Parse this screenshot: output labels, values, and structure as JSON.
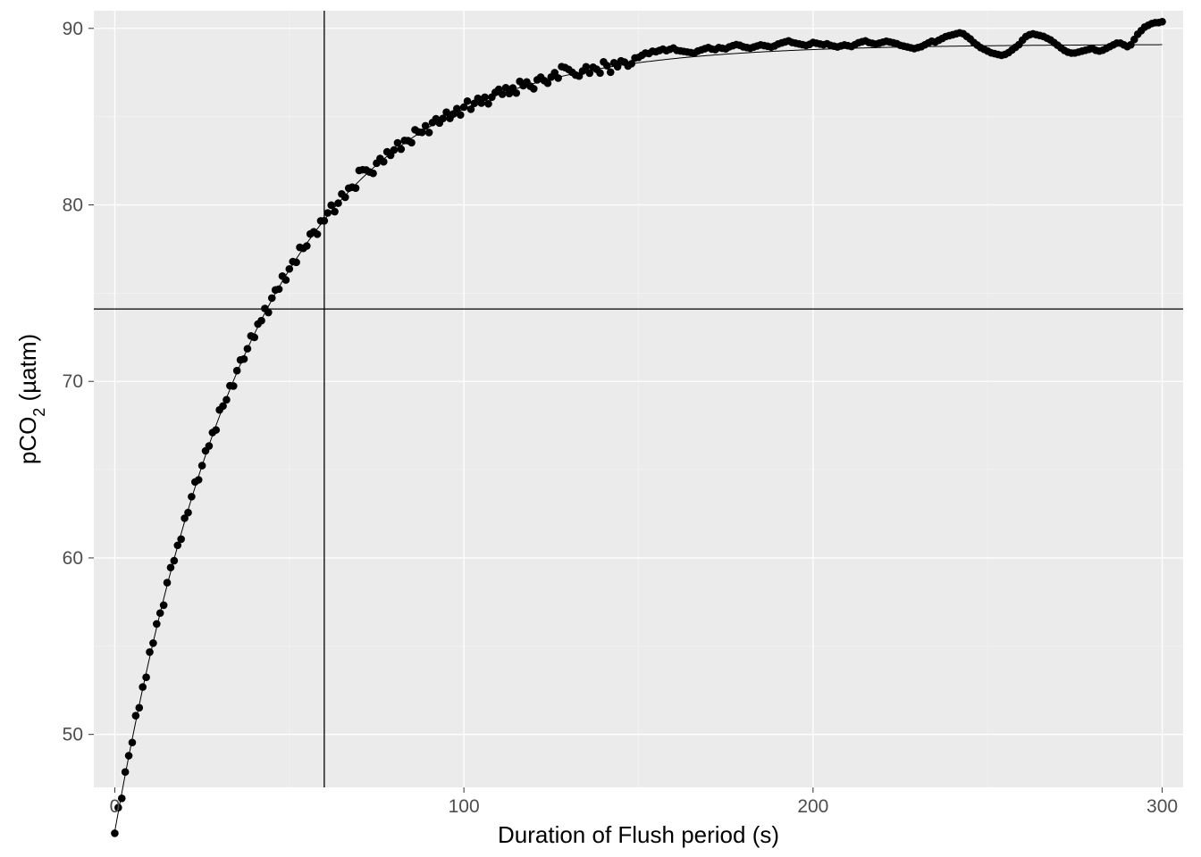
{
  "chart_data": {
    "type": "scatter",
    "xlabel": "Duration of Flush period (s)",
    "ylabel": "pCO₂ (µatm)",
    "xlim": [
      -6,
      306
    ],
    "ylim": [
      47,
      91
    ],
    "x_ticks": [
      0,
      100,
      200,
      300
    ],
    "y_ticks": [
      50,
      60,
      70,
      80,
      90
    ],
    "x_minor": [
      50,
      150,
      250
    ],
    "y_minor": [
      55,
      65,
      75,
      85
    ],
    "vline": 60,
    "hline": 74.1,
    "fit": {
      "A": 44.6,
      "k": 0.025,
      "C": 89.1
    },
    "noise": [
      -0.1,
      0.25,
      -0.3,
      0.15,
      0.05,
      -0.2,
      0.35,
      -0.15,
      0.1,
      -0.25,
      0.3,
      -0.05,
      0.2,
      0.0,
      -0.35,
      0.15,
      0.25,
      -0.1,
      0.05,
      -0.3,
      0.2,
      -0.15,
      0.1,
      0.3,
      -0.2,
      0.0,
      0.25,
      -0.05,
      0.15,
      -0.25,
      0.35,
      0.05,
      -0.1,
      0.2,
      -0.3,
      0.1,
      0.25,
      -0.15,
      0.0,
      0.3,
      -0.2,
      0.15,
      -0.05,
      0.25,
      -0.35,
      0.1,
      0.2,
      -0.1,
      0.3,
      -0.25,
      0.05,
      0.15,
      -0.2,
      0.35,
      0.0,
      -0.15,
      0.25,
      0.1,
      -0.3,
      0.2,
      -0.05,
      0.15,
      0.35,
      -0.25,
      0.0,
      0.3,
      -0.1,
      0.2,
      0.05,
      -0.2,
      0.6,
      0.45,
      0.25,
      -0.05,
      -0.3,
      0.1,
      0.2,
      -0.15,
      0.25,
      -0.1,
      0.05,
      0.3,
      -0.2,
      0.15,
      0.0,
      -0.25,
      0.35,
      0.1,
      -0.05,
      0.2,
      -0.3,
      0.15,
      0.25,
      -0.1,
      0.05,
      0.3,
      -0.15,
      0.0,
      0.2,
      -0.25,
      0.1,
      0.35,
      -0.2,
      0.05,
      0.25,
      -0.1,
      0.15,
      -0.3,
      0.0,
      0.2,
      0.3,
      -0.05,
      0.25,
      -0.15,
      0.1,
      -0.25,
      0.35,
      0.05,
      0.2,
      -0.1,
      -0.3,
      0.15,
      0.25,
      0.0,
      -0.2,
      0.1,
      0.3,
      -0.05,
      0.55,
      0.45,
      0.3,
      0.1,
      -0.1,
      -0.2,
      0.05,
      0.25,
      -0.15,
      0.15,
      0.0,
      -0.25,
      0.35,
      0.1,
      -0.3,
      0.2,
      -0.05,
      0.25,
      0.15,
      -0.1,
      0.0,
      0.3,
      0.3,
      0.4,
      0.5,
      0.45,
      0.55,
      0.5,
      0.55,
      0.6,
      0.5,
      0.55,
      0.6,
      0.45,
      0.4,
      0.35,
      0.3,
      0.25,
      0.2,
      0.3,
      0.35,
      0.4,
      0.45,
      0.35,
      0.3,
      0.4,
      0.35,
      0.3,
      0.4,
      0.45,
      0.5,
      0.45,
      0.35,
      0.3,
      0.25,
      0.3,
      0.35,
      0.4,
      0.35,
      0.3,
      0.25,
      0.3,
      0.4,
      0.45,
      0.5,
      0.55,
      0.45,
      0.4,
      0.35,
      0.3,
      0.25,
      0.3,
      0.4,
      0.35,
      0.3,
      0.25,
      0.3,
      0.2,
      0.15,
      0.1,
      0.15,
      0.2,
      0.15,
      0.1,
      0.2,
      0.3,
      0.35,
      0.4,
      0.3,
      0.25,
      0.2,
      0.25,
      0.3,
      0.35,
      0.3,
      0.25,
      0.2,
      0.1,
      0.05,
      0.0,
      -0.05,
      -0.1,
      -0.05,
      0.0,
      0.1,
      0.2,
      0.3,
      0.25,
      0.35,
      0.45,
      0.55,
      0.6,
      0.65,
      0.7,
      0.75,
      0.7,
      0.55,
      0.4,
      0.2,
      0.05,
      -0.1,
      -0.2,
      -0.3,
      -0.4,
      -0.45,
      -0.5,
      -0.55,
      -0.5,
      -0.4,
      -0.25,
      -0.1,
      0.05,
      0.3,
      0.5,
      0.6,
      0.65,
      0.6,
      0.55,
      0.5,
      0.4,
      0.3,
      0.15,
      0.0,
      -0.15,
      -0.3,
      -0.4,
      -0.45,
      -0.45,
      -0.4,
      -0.35,
      -0.3,
      -0.25,
      -0.2,
      -0.3,
      -0.35,
      -0.3,
      -0.2,
      -0.1,
      0.0,
      0.1,
      0.1,
      0.0,
      -0.1,
      0.0,
      0.3,
      0.6,
      0.8,
      1.0,
      1.1,
      1.2,
      1.25,
      1.25,
      1.3
    ]
  },
  "labels": {
    "xlabel": "Duration of Flush period (s)",
    "ylabel_html": "pCO<tspan baseline-shift=\"sub\" font-size=\"18\">2</tspan> (µatm)"
  }
}
